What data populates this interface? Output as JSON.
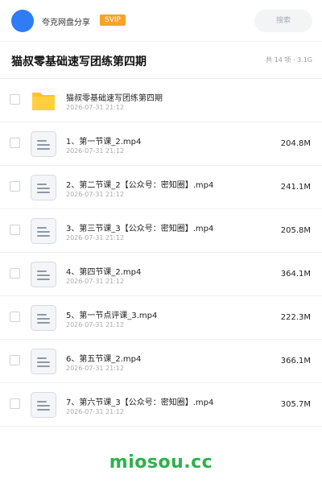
{
  "header": {
    "uploader": "夸克网盘分享",
    "badge": "SVIP",
    "search_placeholder": "搜索"
  },
  "folder": {
    "title": "猫叔零基础速写团练第四期",
    "summary": "共 14 项 · 3.1G"
  },
  "files": [
    {
      "name": "猫叔零基础速写团练第四期",
      "date": "2026-07-31 21:12",
      "size": "",
      "type": "folder",
      "icon": "folder-icon"
    },
    {
      "name": "1、第一节课_2.mp4",
      "date": "2026-07-31 21:12",
      "size": "204.8M",
      "type": "file",
      "icon": "document-icon"
    },
    {
      "name": "2、第二节课_2【公众号：密知圈】.mp4",
      "date": "2026-07-31 21:12",
      "size": "241.1M",
      "type": "file",
      "icon": "document-icon"
    },
    {
      "name": "3、第三节课_3【公众号：密知圈】.mp4",
      "date": "2026-07-31 21:12",
      "size": "205.8M",
      "type": "file",
      "icon": "document-icon"
    },
    {
      "name": "4、第四节课_2.mp4",
      "date": "2026-07-31 21:12",
      "size": "364.1M",
      "type": "file",
      "icon": "document-icon"
    },
    {
      "name": "5、第一节点评课_3.mp4",
      "date": "2026-07-31 21:12",
      "size": "222.3M",
      "type": "file",
      "icon": "document-icon"
    },
    {
      "name": "6、第五节课_2.mp4",
      "date": "2026-07-31 21:12",
      "size": "366.1M",
      "type": "file",
      "icon": "document-icon"
    },
    {
      "name": "7、第六节课_3【公众号：密知圈】.mp4",
      "date": "2026-07-31 21:12",
      "size": "305.7M",
      "type": "file",
      "icon": "document-icon"
    }
  ],
  "watermark": "miosou.cc",
  "colors": {
    "accent": "#2f7cf6",
    "badge": "#f7a228",
    "folder": "#ffc41c",
    "watermark": "#2bb24c"
  }
}
